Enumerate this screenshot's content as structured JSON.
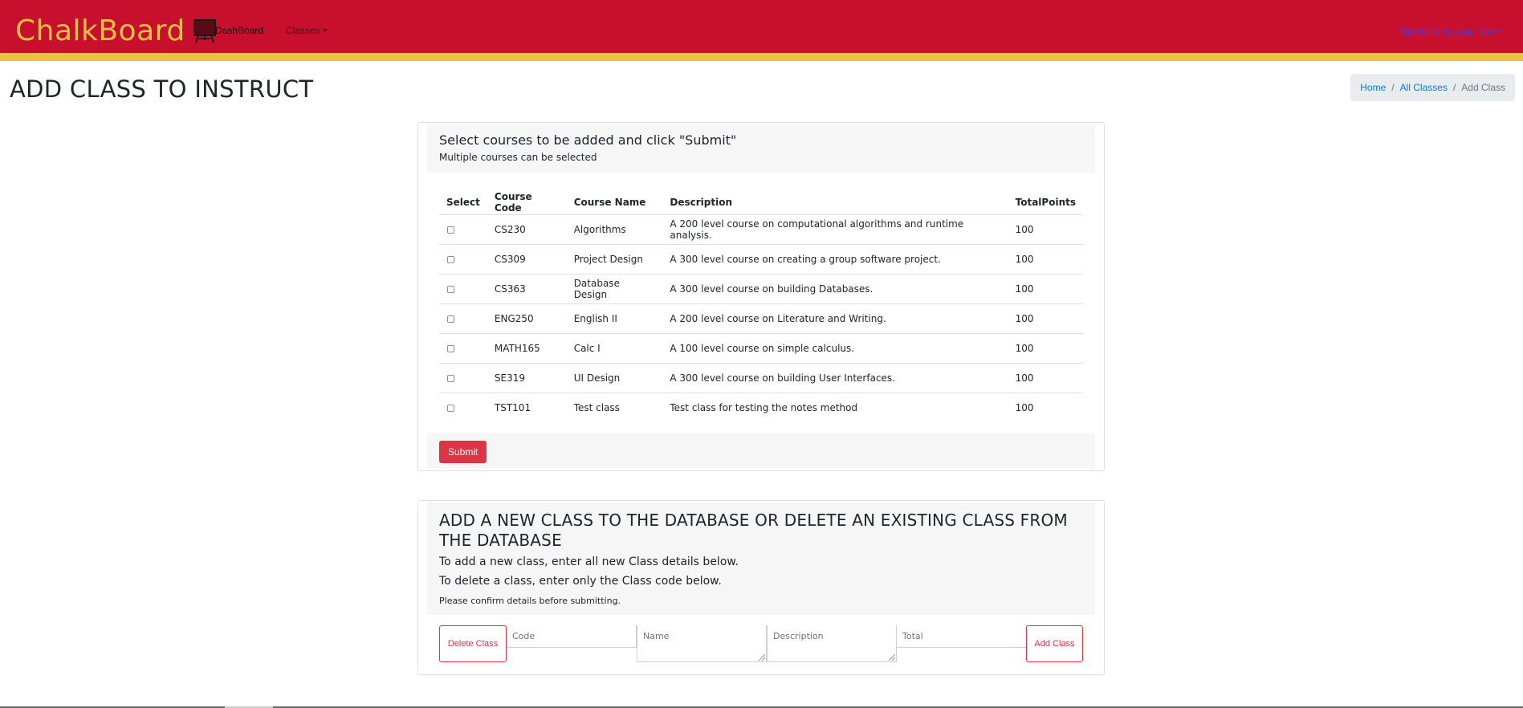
{
  "navbar": {
    "brand": "ChalkBoard",
    "brand_icon": "chalkboard-icon",
    "dashboard": "DashBoard",
    "classes": "Classes",
    "user": "Signed in as Jane Doe"
  },
  "page": {
    "title": "ADD CLASS TO INSTRUCT"
  },
  "breadcrumb": {
    "home": "Home",
    "all_classes": "All Classes",
    "current": "Add Class"
  },
  "select_card": {
    "title": "Select courses to be added and click \"Submit\"",
    "subtitle": "Multiple courses can be selected",
    "columns": [
      "Select",
      "Course Code",
      "Course Name",
      "Description",
      "TotalPoints"
    ],
    "rows": [
      {
        "code": "CS230",
        "name": "Algorithms",
        "description": "A 200 level course on computational algorithms and runtime analysis.",
        "points": "100"
      },
      {
        "code": "CS309",
        "name": "Project Design",
        "description": "A 300 level course on creating a group software project.",
        "points": "100"
      },
      {
        "code": "CS363",
        "name": "Database Design",
        "description": "A 300 level course on building Databases.",
        "points": "100"
      },
      {
        "code": "ENG250",
        "name": "English II",
        "description": "A 200 level course on Literature and Writing.",
        "points": "100"
      },
      {
        "code": "MATH165",
        "name": "Calc I",
        "description": "A 100 level course on simple calculus.",
        "points": "100"
      },
      {
        "code": "SE319",
        "name": "UI Design",
        "description": "A 300 level course on building User Interfaces.",
        "points": "100"
      },
      {
        "code": "TST101",
        "name": "Test class",
        "description": "Test class for testing the notes method",
        "points": "100"
      }
    ],
    "submit": "Submit"
  },
  "manage_card": {
    "title": "ADD A NEW CLASS TO THE DATABASE OR DELETE AN EXISTING CLASS FROM THE DATABASE",
    "line1": "To add a new class, enter all new Class details below.",
    "line2": "To delete a class, enter only the Class code below.",
    "line3": "Please confirm details before submitting.",
    "delete_button": "Delete Class",
    "add_button": "Add Class",
    "placeholders": {
      "code": "Code",
      "name": "Name",
      "description": "Description",
      "total": "Total"
    }
  },
  "colors": {
    "primary_red": "#c8102e",
    "accent_gold": "#f1be48",
    "danger": "#dc3545",
    "link_blue": "#007bff"
  }
}
